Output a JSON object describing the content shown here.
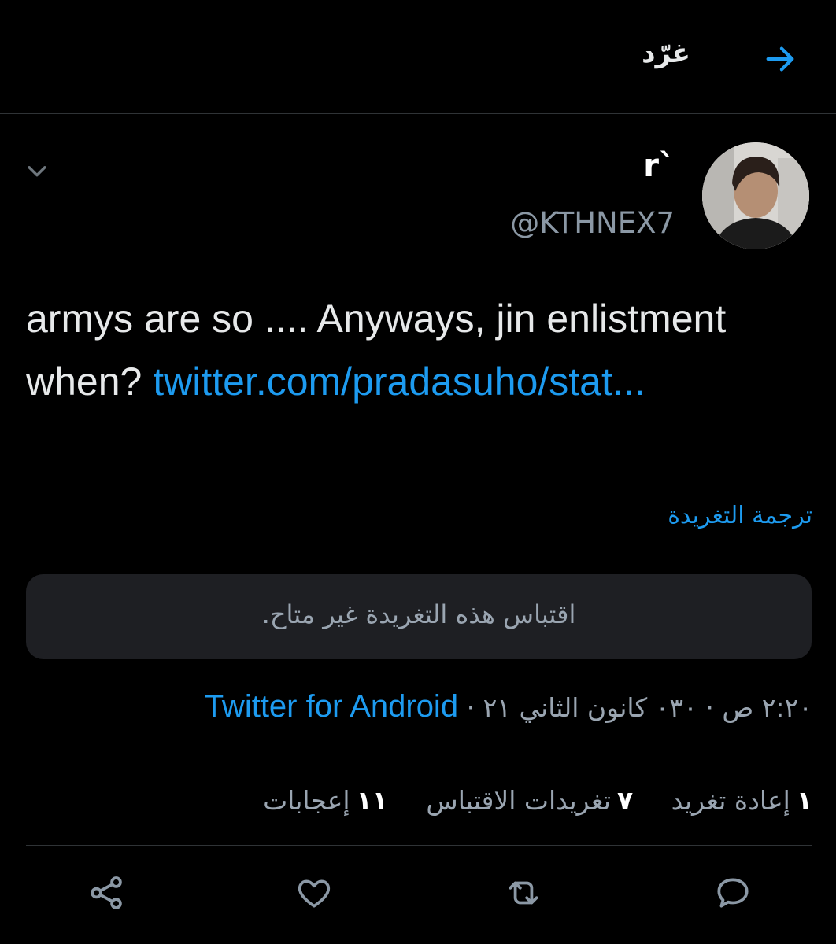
{
  "header": {
    "title": "غرّد",
    "back_icon": "arrow-right-icon"
  },
  "tweet": {
    "display_name": "r`",
    "handle": "@KTHNEX7",
    "text": "armys are so .... Anyways, jin enlistment when? ",
    "link_text": "twitter.com/pradasuho/stat...",
    "translate_label": "ترجمة التغريدة",
    "quote_unavailable": "اقتباس هذه التغريدة غير متاح.",
    "timestamp": "٢:٢٠ ص · ٠٣٠ كانون الثاني ٢١ · ",
    "source": "Twitter for Android"
  },
  "stats": {
    "retweets_count": "١",
    "retweets_label": "إعادة تغريد",
    "quotes_count": "٧",
    "quotes_label": "تغريدات الاقتباس",
    "likes_count": "١١",
    "likes_label": "إعجابات"
  },
  "colors": {
    "background": "#000000",
    "accent": "#1d9bf0",
    "muted": "#9aa5b1",
    "quote_bg": "#1e1f23"
  },
  "icons": [
    "arrow-right-icon",
    "chevron-down-icon",
    "reply-icon",
    "retweet-icon",
    "like-icon",
    "share-icon"
  ]
}
